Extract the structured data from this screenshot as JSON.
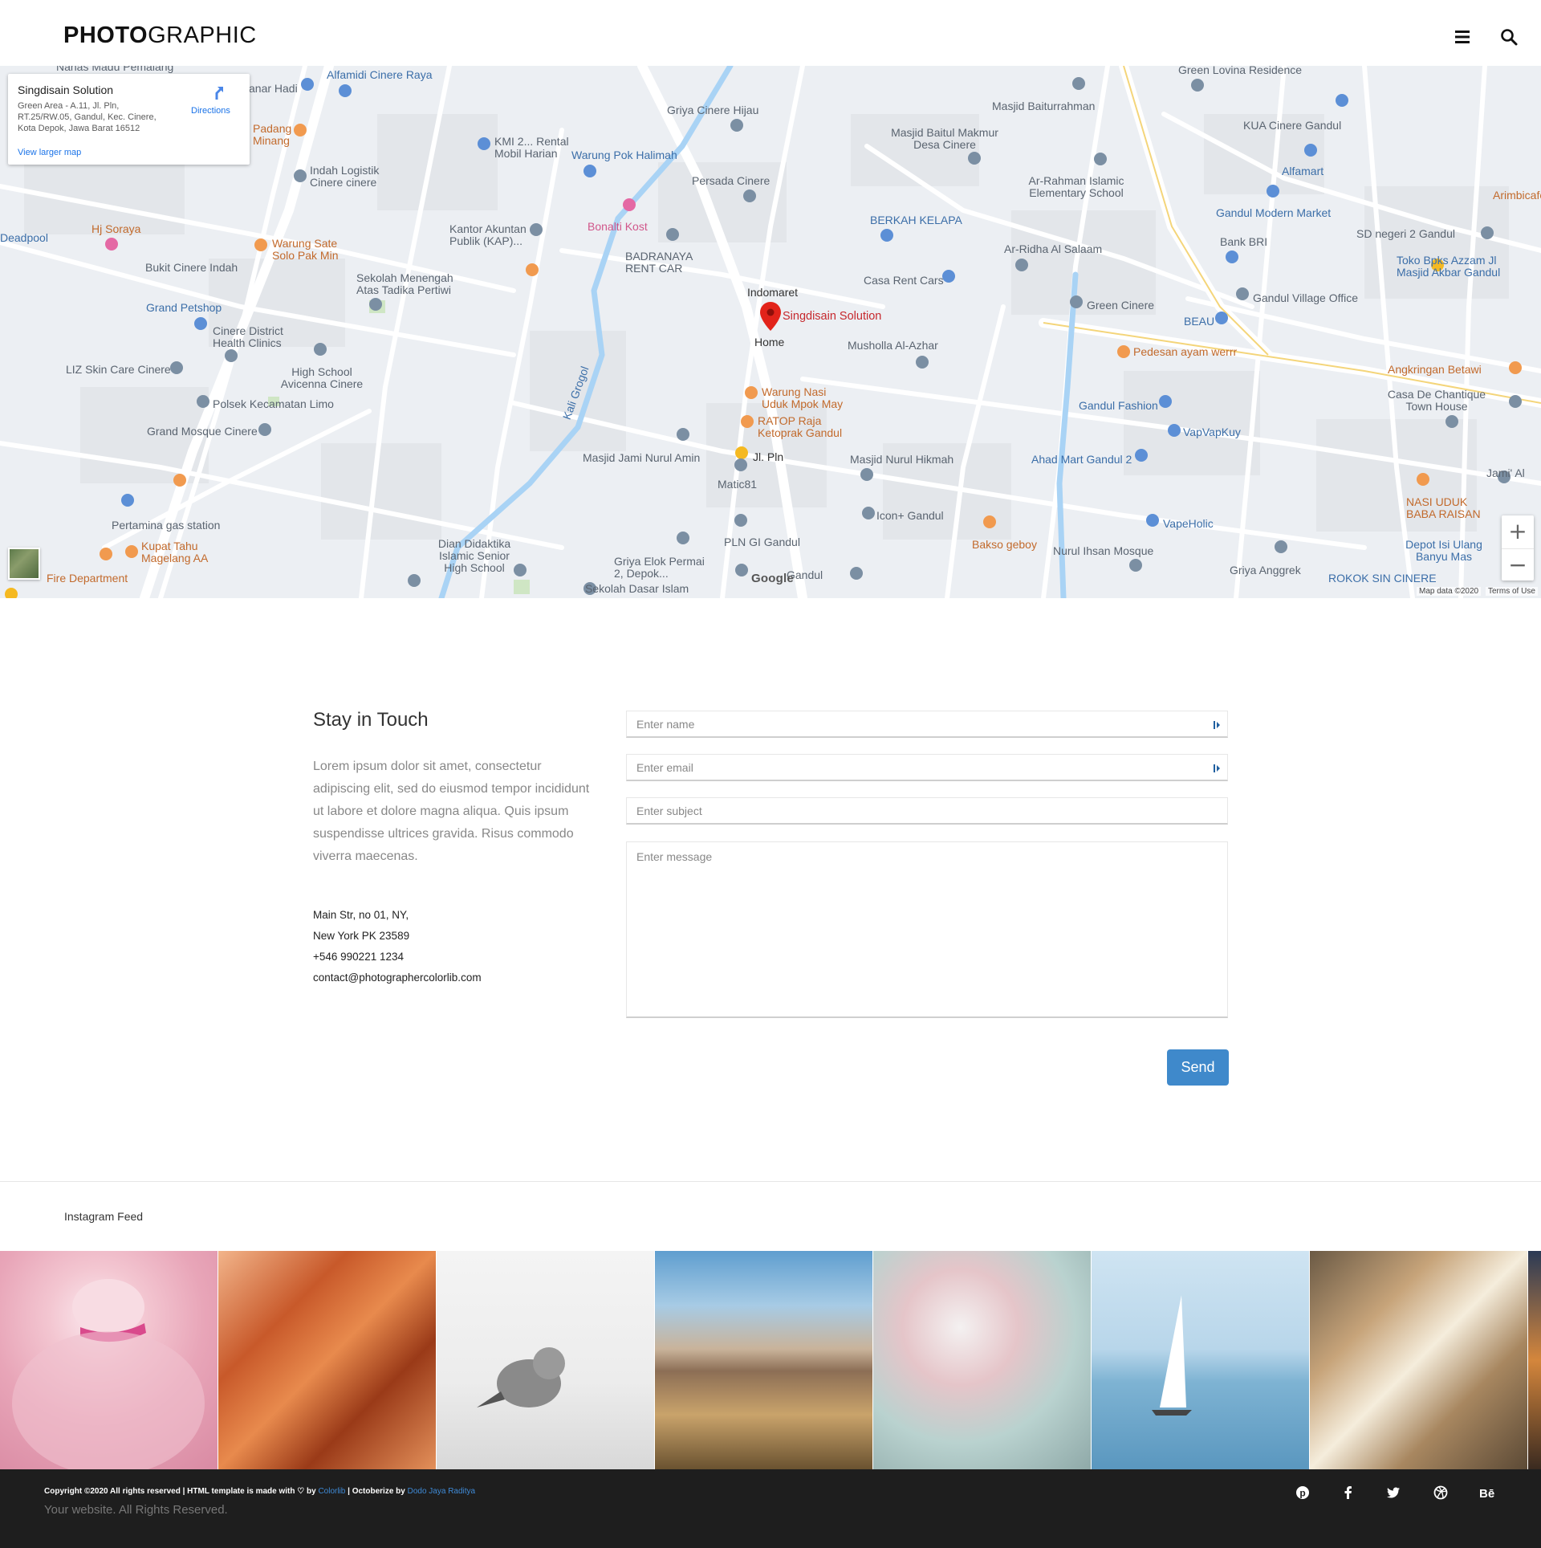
{
  "header": {
    "logo_bold": "PHOTO",
    "logo_light": "GRAPHIC"
  },
  "map": {
    "info": {
      "place_name": "Singdisain Solution",
      "address": "Green Area - A.11, Jl. Pln, RT.25/RW.05, Gandul, Kec. Cinere, Kota Depok, Jawa Barat 16512",
      "directions_label": "Directions",
      "larger_map_label": "View larger map"
    },
    "main_place": "Singdisain Solution",
    "labels": [
      "Nanas Madu Pemalang",
      "Alfamidi Cinere Raya",
      "anar Hadi",
      "Griya Cinere Hijau",
      "Masjid Baiturrahman",
      "Green Lovina Residence",
      "KUA Cinere Gandul",
      "Padang Minang",
      "KMI 2... Rental Mobil Harian",
      "Masjid Baitul Makmur Desa Cinere",
      "Warung Pok Halimah",
      "Indah Logistik Cinere cinere",
      "Persada Cinere",
      "Ar-Rahman Islamic Elementary School",
      "Alfamart",
      "Arimbicafe",
      "Deadpool",
      "Hj Soraya",
      "Bonalti Kost",
      "Kantor Akuntan Publik (KAP)...",
      "BERKAH KELAPA",
      "Gandul Modern Market",
      "Bank BRI",
      "SD negeri 2 Gandul",
      "Warung Sate Solo Pak Min",
      "BADRANAYA RENT CAR",
      "Ar-Ridha Al Salaam",
      "Toko Bpks Azzam Jl Masjid Akbar Gandul",
      "Bukit Cinere Indah",
      "Sekolah Menengah Atas Tadika Pertiwi",
      "Indomaret",
      "Casa Rent Cars",
      "Gandul Village Office",
      "Grand Petshop",
      "Green Cinere",
      "BEAU",
      "Cinere District Health Clinics",
      "Home",
      "Musholla Al-Azhar",
      "Pedesan ayam werrr",
      "LIZ Skin Care Cinere",
      "High School Avicenna Cinere",
      "Warung Nasi Uduk Mpok May",
      "Angkringan Betawi",
      "Polsek Kecamatan Limo",
      "Gandul Fashion",
      "Casa De Chantique Town House",
      "Grand Mosque Cinere",
      "RATOP Raja Ketoprak Gandul",
      "VapVapKuy",
      "Masjid Jami Nurul Amin",
      "Jl. Pln",
      "Masjid Nurul Hikmah",
      "Ahad Mart Gandul 2",
      "Matic81",
      "Jami' Al",
      "NASI UDUK BABA RAISAN",
      "Icon+ Gandul",
      "VapeHolic",
      "Pertamina gas station",
      "Dian Didaktika Islamic Senior High School",
      "PLN GI Gandul",
      "Bakso geboy",
      "Kupat Tahu Magelang AA",
      "Griya Elok Permai 2, Depok...",
      "Nurul Ihsan Mosque",
      "Depot Isi Ulang Banyu Mas",
      "Griya Anggrek",
      "Fire Department",
      "Sekolah Dasar Islam",
      "Gandul",
      "ROKOK SIN CINERE",
      "Kali Grogol"
    ],
    "attribution": "Map data ©2020",
    "terms": "Terms of Use",
    "google": "Google",
    "zoom_in": "+",
    "zoom_out": "−"
  },
  "contact": {
    "title": "Stay in Touch",
    "description": "Lorem ipsum dolor sit amet, consectetur adipiscing elit, sed do eiusmod tempor incididunt ut labore et dolore magna aliqua. Quis ipsum suspendisse ultrices gravida. Risus commodo viverra maecenas.",
    "address_line1": "Main Str, no 01, NY,",
    "address_line2": "New York PK 23589",
    "phone": "+546 990221 1234",
    "email": "contact@photographercolorlib.com",
    "form": {
      "name_placeholder": "Enter name",
      "email_placeholder": "Enter email",
      "subject_placeholder": "Enter subject",
      "message_placeholder": "Enter message",
      "send_label": "Send"
    }
  },
  "instagram": {
    "title": "Instagram Feed",
    "items": [
      "flamingo",
      "canyon",
      "bird",
      "desert",
      "flower",
      "sailboat",
      "street"
    ]
  },
  "footer": {
    "copyright_prefix": "Copyright ©2020 All rights reserved | HTML template is made with ♡ by ",
    "colorlib": "Colorlib",
    "octoberize": " | Octoberize by ",
    "author": "Dodo Jaya Raditya",
    "sub": "Your website. All Rights Reserved.",
    "social_icons": [
      "pinterest-icon",
      "facebook-icon",
      "twitter-icon",
      "dribbble-icon",
      "behance-icon"
    ]
  },
  "colors": {
    "accent": "#3f89cb",
    "footer_bg": "#1e1e1e",
    "link": "#3f8ad6",
    "map_bg": "#eceff3"
  }
}
